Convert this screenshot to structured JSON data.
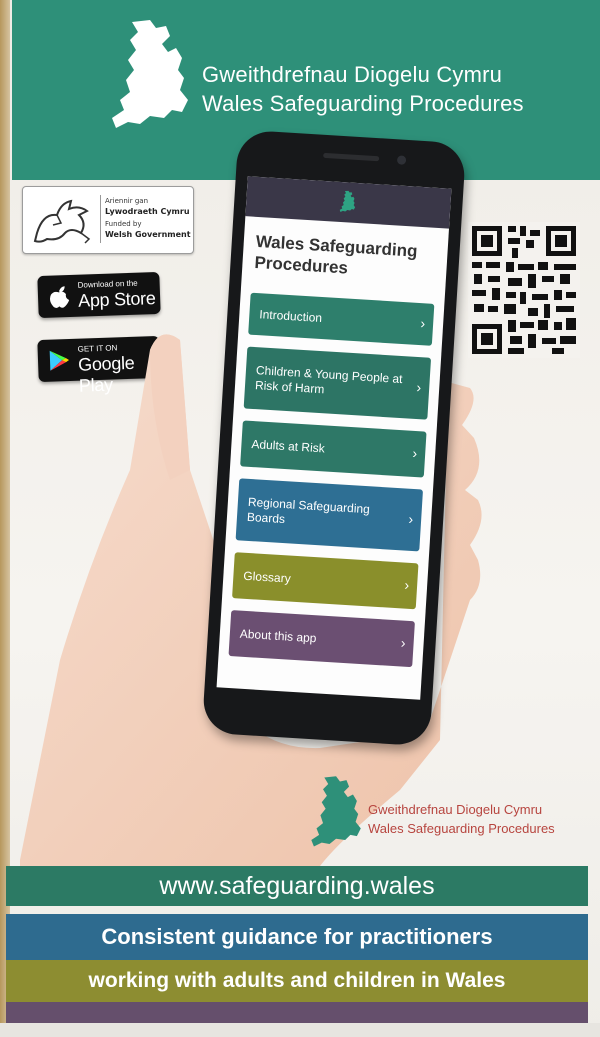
{
  "header": {
    "title_welsh": "Gweithdrefnau Diogelu Cymru",
    "title_english": "Wales Safeguarding Procedures"
  },
  "government_badge": {
    "line1": "Ariennir gan",
    "line2": "Lywodraeth Cymru",
    "line3": "Funded by",
    "line4": "Welsh Government"
  },
  "app_store": {
    "small": "Download on the",
    "large": "App Store"
  },
  "google_play": {
    "small": "GET IT ON",
    "large": "Google Play"
  },
  "app": {
    "title": "Wales Safeguarding Procedures",
    "menu": [
      {
        "label": "Introduction",
        "color": "#2e7f6c"
      },
      {
        "label": "Children & Young People at Risk of Harm",
        "color": "#2d7565"
      },
      {
        "label": "Adults at Risk",
        "color": "#2e7867"
      },
      {
        "label": "Regional Safeguarding Boards",
        "color": "#2e6f94"
      },
      {
        "label": "Glossary",
        "color": "#8a8f2b"
      },
      {
        "label": "About this app",
        "color": "#6b4f72"
      }
    ],
    "chevron": "›"
  },
  "lower_logo": {
    "title_welsh": "Gweithdrefnau Diogelu Cymru",
    "title_english": "Wales Safeguarding Procedures"
  },
  "bands": {
    "url": "www.safeguarding.wales",
    "guidance_line1": "Consistent guidance for practitioners",
    "guidance_line2": "working with adults and children in Wales"
  },
  "colors": {
    "header_green": "#2e9079",
    "band_teal": "#2c7a64",
    "band_blue": "#2e6b8f",
    "band_olive": "#8d8d31",
    "band_purple": "#654f6c",
    "logo_red_text": "#b7453f"
  }
}
